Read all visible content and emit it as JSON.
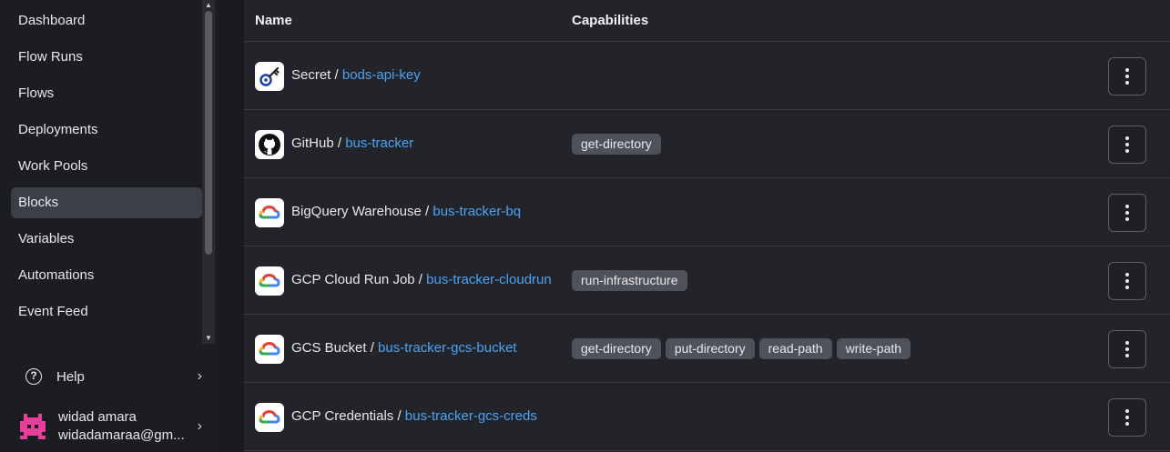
{
  "sidebar": {
    "items": [
      {
        "label": "Dashboard",
        "active": false
      },
      {
        "label": "Flow Runs",
        "active": false
      },
      {
        "label": "Flows",
        "active": false
      },
      {
        "label": "Deployments",
        "active": false
      },
      {
        "label": "Work Pools",
        "active": false
      },
      {
        "label": "Blocks",
        "active": true
      },
      {
        "label": "Variables",
        "active": false
      },
      {
        "label": "Automations",
        "active": false
      },
      {
        "label": "Event Feed",
        "active": false
      }
    ],
    "help_label": "Help",
    "user": {
      "name": "widad amara",
      "email": "widadamaraa@gm..."
    }
  },
  "table": {
    "headers": {
      "name": "Name",
      "capabilities": "Capabilities"
    },
    "rows": [
      {
        "type": "Secret",
        "name": "bods-api-key",
        "icon": "key-icon",
        "capabilities": []
      },
      {
        "type": "GitHub",
        "name": "bus-tracker",
        "icon": "github-icon",
        "capabilities": [
          "get-directory"
        ]
      },
      {
        "type": "BigQuery Warehouse",
        "name": "bus-tracker-bq",
        "icon": "google-cloud-icon",
        "capabilities": []
      },
      {
        "type": "GCP Cloud Run Job",
        "name": "bus-tracker-cloudrun",
        "icon": "google-cloud-icon",
        "capabilities": [
          "run-infrastructure"
        ]
      },
      {
        "type": "GCS Bucket",
        "name": "bus-tracker-gcs-bucket",
        "icon": "google-cloud-icon",
        "capabilities": [
          "get-directory",
          "put-directory",
          "read-path",
          "write-path"
        ]
      },
      {
        "type": "GCP Credentials",
        "name": "bus-tracker-gcs-creds",
        "icon": "google-cloud-icon",
        "capabilities": []
      }
    ]
  },
  "colors": {
    "accent_link": "#4aa3f5",
    "active_nav": "#3c3f4a",
    "badge": "#50525b"
  }
}
